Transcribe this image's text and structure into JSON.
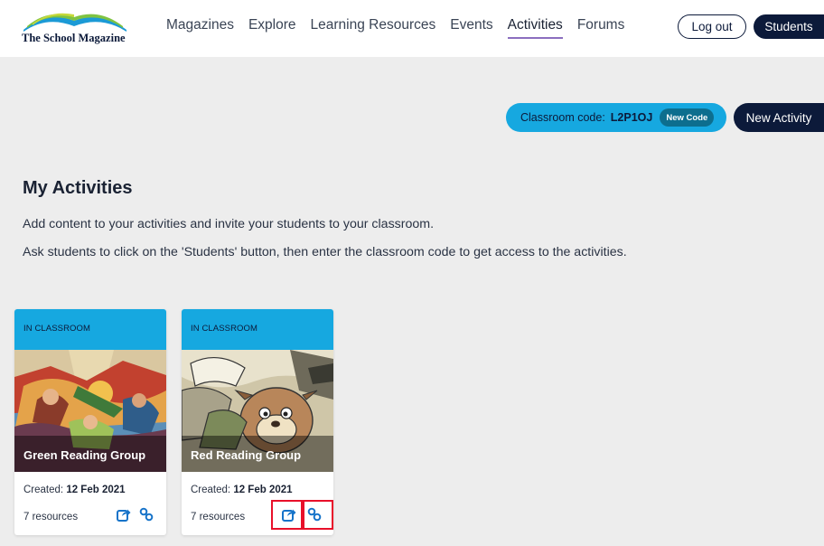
{
  "header": {
    "logo_text": "The School Magazine",
    "nav": [
      "Magazines",
      "Explore",
      "Learning Resources",
      "Events",
      "Activities",
      "Forums"
    ],
    "active_nav": "Activities",
    "logout_label": "Log out",
    "students_label": "Students"
  },
  "classroom": {
    "code_label": "Classroom code:",
    "code_value": "L2P1OJ",
    "new_code_label": "New Code",
    "new_activity_label": "New Activity"
  },
  "main": {
    "title": "My Activities",
    "description_1": "Add content to your activities and invite your students to your classroom.",
    "description_2": "Ask students to click on the 'Students' button, then enter the classroom code to get access to the activities."
  },
  "cards": [
    {
      "status": "IN CLASSROOM",
      "title": "Green Reading Group",
      "created_label": "Created:",
      "created_date": "12 Feb 2021",
      "resources": "7 resources"
    },
    {
      "status": "IN CLASSROOM",
      "title": "Red Reading Group",
      "created_label": "Created:",
      "created_date": "12 Feb 2021",
      "resources": "7 resources"
    }
  ],
  "colors": {
    "navy": "#0c1a3a",
    "accent_blue": "#16a8e0",
    "highlight_red": "#e8102a",
    "icon_blue": "#1673c9"
  }
}
